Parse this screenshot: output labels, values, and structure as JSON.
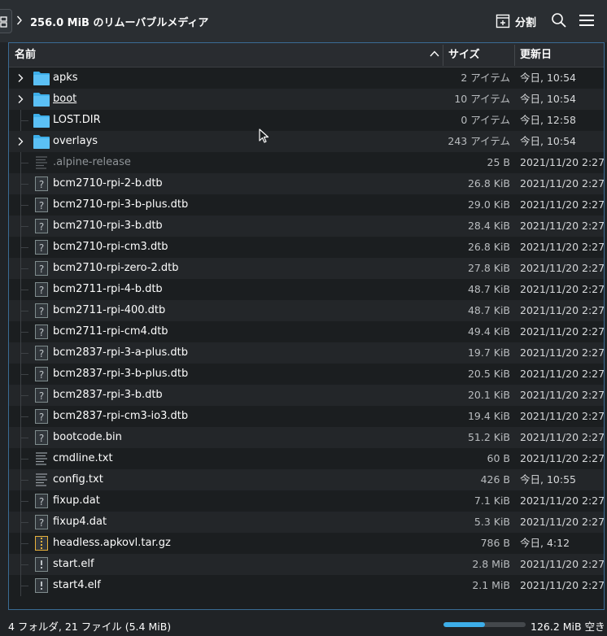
{
  "toolbar": {
    "location": "256.0 MiB のリムーバブルメディア",
    "split_label": "分割"
  },
  "columns": {
    "name": "名前",
    "size": "サイズ",
    "modified": "更新日"
  },
  "files": [
    {
      "name": "apks",
      "type": "folder",
      "expandable": true,
      "size": "2 アイテム",
      "date": "今日, 10:54"
    },
    {
      "name": "boot",
      "type": "folder",
      "expandable": true,
      "size": "10 アイテム",
      "date": "今日, 10:54"
    },
    {
      "name": "LOST.DIR",
      "type": "folder",
      "expandable": false,
      "size": "0 アイテム",
      "date": "今日, 12:58"
    },
    {
      "name": "overlays",
      "type": "folder",
      "expandable": true,
      "size": "243 アイテム",
      "date": "今日, 10:54"
    },
    {
      "name": ".alpine-release",
      "type": "text-hidden",
      "size": "25 B",
      "date": "2021/11/20 2:27"
    },
    {
      "name": "bcm2710-rpi-2-b.dtb",
      "type": "unknown",
      "size": "26.8 KiB",
      "date": "2021/11/20 2:27"
    },
    {
      "name": "bcm2710-rpi-3-b-plus.dtb",
      "type": "unknown",
      "size": "29.0 KiB",
      "date": "2021/11/20 2:27"
    },
    {
      "name": "bcm2710-rpi-3-b.dtb",
      "type": "unknown",
      "size": "28.4 KiB",
      "date": "2021/11/20 2:27"
    },
    {
      "name": "bcm2710-rpi-cm3.dtb",
      "type": "unknown",
      "size": "26.8 KiB",
      "date": "2021/11/20 2:27"
    },
    {
      "name": "bcm2710-rpi-zero-2.dtb",
      "type": "unknown",
      "size": "27.8 KiB",
      "date": "2021/11/20 2:27"
    },
    {
      "name": "bcm2711-rpi-4-b.dtb",
      "type": "unknown",
      "size": "48.7 KiB",
      "date": "2021/11/20 2:27"
    },
    {
      "name": "bcm2711-rpi-400.dtb",
      "type": "unknown",
      "size": "48.7 KiB",
      "date": "2021/11/20 2:27"
    },
    {
      "name": "bcm2711-rpi-cm4.dtb",
      "type": "unknown",
      "size": "49.4 KiB",
      "date": "2021/11/20 2:27"
    },
    {
      "name": "bcm2837-rpi-3-a-plus.dtb",
      "type": "unknown",
      "size": "19.7 KiB",
      "date": "2021/11/20 2:27"
    },
    {
      "name": "bcm2837-rpi-3-b-plus.dtb",
      "type": "unknown",
      "size": "20.5 KiB",
      "date": "2021/11/20 2:27"
    },
    {
      "name": "bcm2837-rpi-3-b.dtb",
      "type": "unknown",
      "size": "20.1 KiB",
      "date": "2021/11/20 2:27"
    },
    {
      "name": "bcm2837-rpi-cm3-io3.dtb",
      "type": "unknown",
      "size": "19.4 KiB",
      "date": "2021/11/20 2:27"
    },
    {
      "name": "bootcode.bin",
      "type": "unknown",
      "size": "51.2 KiB",
      "date": "2021/11/20 2:27"
    },
    {
      "name": "cmdline.txt",
      "type": "text",
      "size": "60 B",
      "date": "2021/11/20 2:27"
    },
    {
      "name": "config.txt",
      "type": "text",
      "size": "426 B",
      "date": "今日, 10:55"
    },
    {
      "name": "fixup.dat",
      "type": "unknown",
      "size": "7.1 KiB",
      "date": "2021/11/20 2:27"
    },
    {
      "name": "fixup4.dat",
      "type": "unknown",
      "size": "5.3 KiB",
      "date": "2021/11/20 2:27"
    },
    {
      "name": "headless.apkovl.tar.gz",
      "type": "archive",
      "size": "786 B",
      "date": "今日, 4:12"
    },
    {
      "name": "start.elf",
      "type": "executable",
      "size": "2.8 MiB",
      "date": "2021/11/20 2:27"
    },
    {
      "name": "start4.elf",
      "type": "executable",
      "size": "2.1 MiB",
      "date": "2021/11/20 2:27"
    }
  ],
  "status": {
    "summary": "4 フォルダ, 21 ファイル (5.4 MiB)",
    "free_space": "126.2 MiB 空き",
    "used_fraction": 0.5
  },
  "colors": {
    "accent": "#3daee9",
    "folder": "#3daee9",
    "archive": "#e8b23c"
  }
}
